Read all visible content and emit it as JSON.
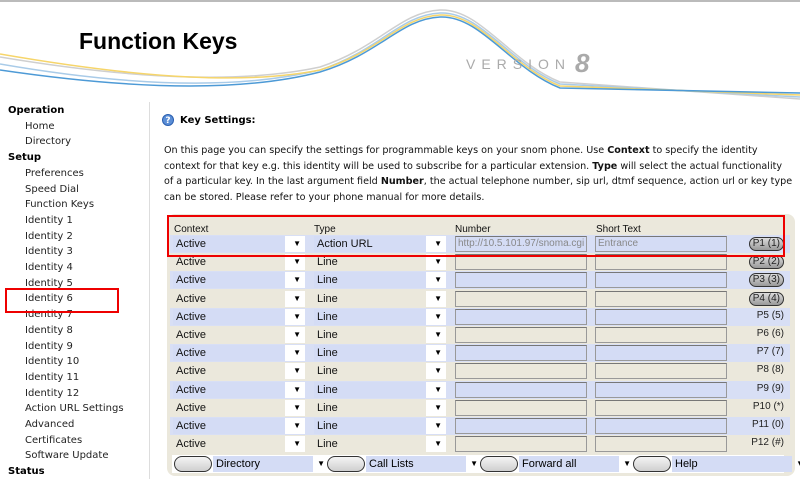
{
  "header": {
    "title": "Function Keys",
    "version_label": "VERSION",
    "version_number": "8"
  },
  "sidebar": {
    "sections": [
      {
        "label": "Operation",
        "items": [
          "Home",
          "Directory"
        ]
      },
      {
        "label": "Setup",
        "items": [
          "Preferences",
          "Speed Dial",
          "Function Keys",
          "Identity 1",
          "Identity 2",
          "Identity 3",
          "Identity 4",
          "Identity 5",
          "Identity 6",
          "Identity 7",
          "Identity 8",
          "Identity 9",
          "Identity 10",
          "Identity 11",
          "Identity 12",
          "Action URL Settings",
          "Advanced",
          "Certificates",
          "Software Update"
        ]
      },
      {
        "label": "Status",
        "items": []
      }
    ],
    "selected": "Function Keys"
  },
  "main": {
    "section_title": "Key Settings:",
    "description": [
      {
        "t": "On this page you can specify the settings for programmable keys on your snom phone. Use "
      },
      {
        "b": "Context"
      },
      {
        "t": " to specify the identity context for that key e.g. this identity will be used to subscribe for a particular extension. "
      },
      {
        "b": "Type"
      },
      {
        "t": " will select the actual functionality of a particular key. In the last argument field "
      },
      {
        "b": "Number"
      },
      {
        "t": ", the actual telephone number, sip url, dtmf sequence, action url or key type can be stored. Please refer to your phone manual for more details."
      }
    ],
    "columns": {
      "context": "Context",
      "type": "Type",
      "number": "Number",
      "short_text": "Short Text"
    },
    "rows": [
      {
        "context": "Active",
        "type": "Action URL",
        "number": "http://10.5.101.97/snoma.cgi",
        "short_text": "Entrance",
        "key": "P1 (1)",
        "button": true
      },
      {
        "context": "Active",
        "type": "Line",
        "number": "",
        "short_text": "",
        "key": "P2 (2)",
        "button": true
      },
      {
        "context": "Active",
        "type": "Line",
        "number": "",
        "short_text": "",
        "key": "P3 (3)",
        "button": true
      },
      {
        "context": "Active",
        "type": "Line",
        "number": "",
        "short_text": "",
        "key": "P4 (4)",
        "button": true
      },
      {
        "context": "Active",
        "type": "Line",
        "number": "",
        "short_text": "",
        "key": "P5 (5)",
        "button": false
      },
      {
        "context": "Active",
        "type": "Line",
        "number": "",
        "short_text": "",
        "key": "P6 (6)",
        "button": false
      },
      {
        "context": "Active",
        "type": "Line",
        "number": "",
        "short_text": "",
        "key": "P7 (7)",
        "button": false
      },
      {
        "context": "Active",
        "type": "Line",
        "number": "",
        "short_text": "",
        "key": "P8 (8)",
        "button": false
      },
      {
        "context": "Active",
        "type": "Line",
        "number": "",
        "short_text": "",
        "key": "P9 (9)",
        "button": false
      },
      {
        "context": "Active",
        "type": "Line",
        "number": "",
        "short_text": "",
        "key": "P10 (*)",
        "button": false
      },
      {
        "context": "Active",
        "type": "Line",
        "number": "",
        "short_text": "",
        "key": "P11 (0)",
        "button": false
      },
      {
        "context": "Active",
        "type": "Line",
        "number": "",
        "short_text": "",
        "key": "P12 (#)",
        "button": false
      }
    ],
    "softkeys": [
      "Directory",
      "Call Lists",
      "Forward all",
      "Help"
    ]
  },
  "colors": {
    "highlight_border": "#ee0000",
    "row_alt": "#d8dff5",
    "panel": "#ebe8dc"
  }
}
